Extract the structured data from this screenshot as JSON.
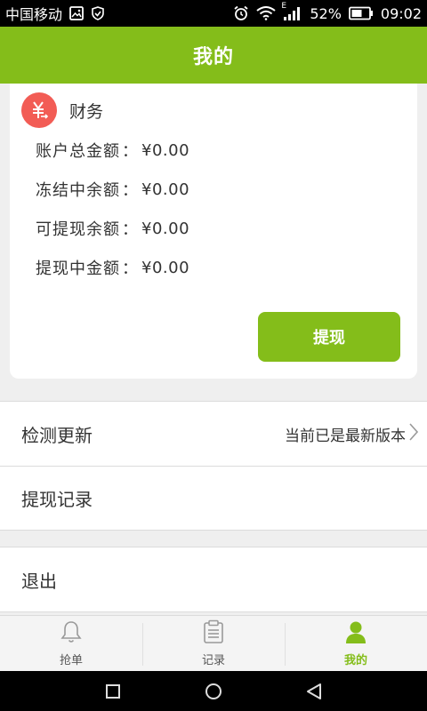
{
  "status_bar": {
    "carrier": "中国移动",
    "battery": "52%",
    "time": "09:02",
    "network_letter": "E",
    "icons": [
      "image-icon",
      "shield-icon",
      "alarm-icon",
      "wifi-icon",
      "signal-icon",
      "battery-icon"
    ]
  },
  "header": {
    "title": "我的"
  },
  "finance": {
    "icon": "yuan-icon",
    "title": "财务",
    "rows": [
      {
        "label": "账户总金额",
        "sep": "：",
        "value": "¥0.00"
      },
      {
        "label": "冻结中余额",
        "sep": "：",
        "value": "¥0.00"
      },
      {
        "label": "可提现余额",
        "sep": "：",
        "value": "¥0.00"
      },
      {
        "label": "提现中金额",
        "sep": "：",
        "value": "¥0.00"
      }
    ],
    "withdraw_label": "提现"
  },
  "menu": {
    "check_update": {
      "label": "检测更新",
      "status": "当前已是最新版本"
    },
    "withdraw_record": {
      "label": "提现记录"
    },
    "logout": {
      "label": "退出"
    }
  },
  "tabs": [
    {
      "label": "抢单",
      "icon": "bell-icon"
    },
    {
      "label": "记录",
      "icon": "clipboard-icon"
    },
    {
      "label": "我的",
      "icon": "user-icon"
    }
  ],
  "colors": {
    "accent": "#84bd1a",
    "finance_icon": "#f25c55"
  }
}
